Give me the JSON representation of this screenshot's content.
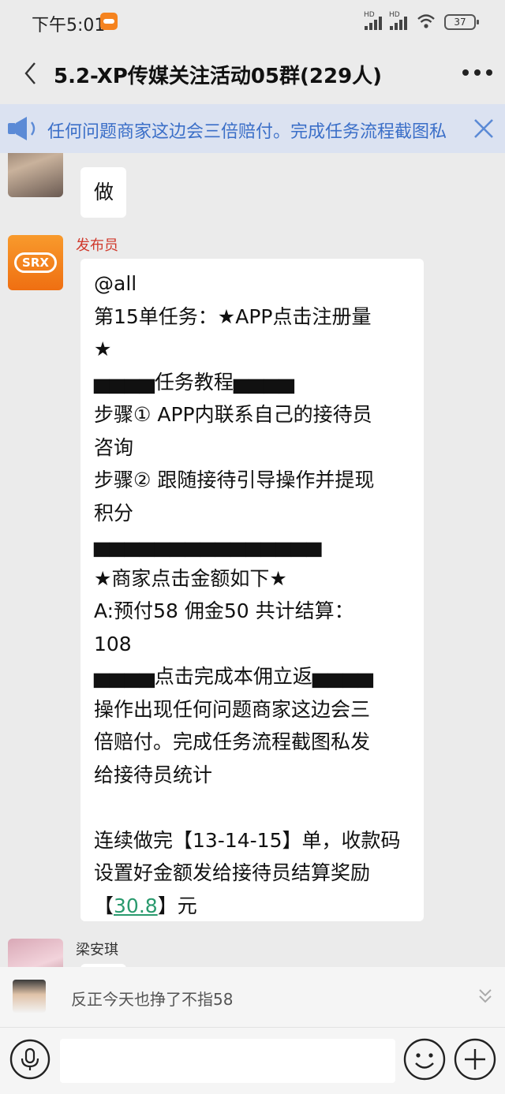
{
  "status_bar": {
    "time": "下午5:01",
    "hd_label": "HD",
    "battery": "37"
  },
  "header": {
    "title": "5.2-XP传媒关注活动05群(229人)"
  },
  "notice": {
    "text": "任何问题商家这边会三倍赔付。完成任务流程截图私"
  },
  "messages": [
    {
      "sender": "",
      "text": "做"
    },
    {
      "sender": "发布员",
      "avatar_label": "SRX",
      "lines": [
        "@all",
        "第15单任务：★APP点击注册量",
        "★",
        "▅▅▅▅任务教程▅▅▅▅",
        "步骤① APP内联系自己的接待员",
        "咨询",
        "步骤② 跟随接待引导操作并提现",
        "积分",
        "▅▅▅▅▅▅▅▅▅▅▅▅▅▅▅",
        "★商家点击金额如下★",
        "A:预付58  佣金50  共计结算：",
        "108",
        "▅▅▅▅点击完成本佣立返▅▅▅▅",
        "操作出现任何问题商家这边会三",
        "倍赔付。完成任务流程截图私发",
        "给接待员统计",
        "",
        "连续做完【13-14-15】单，收款码",
        "设置好金额发给接待员结算奖励"
      ],
      "last_line_prefix": "【",
      "last_line_link": "30.8",
      "last_line_suffix": "】元"
    },
    {
      "sender": "梁安琪"
    }
  ],
  "preview": {
    "text": "反正今天也挣了不指58"
  },
  "input": {
    "placeholder": ""
  },
  "colors": {
    "background": "#ebebeb",
    "notice_bg": "#dbe2f1",
    "notice_text": "#3b6fc8",
    "sender_highlight": "#d0392b",
    "link": "#2a9a6e",
    "srx_orange": "#f5831f"
  },
  "icons": [
    "back-icon",
    "more-icon",
    "speaker-icon",
    "close-icon",
    "voice-icon",
    "emoji-icon",
    "plus-icon",
    "expand-icon"
  ]
}
